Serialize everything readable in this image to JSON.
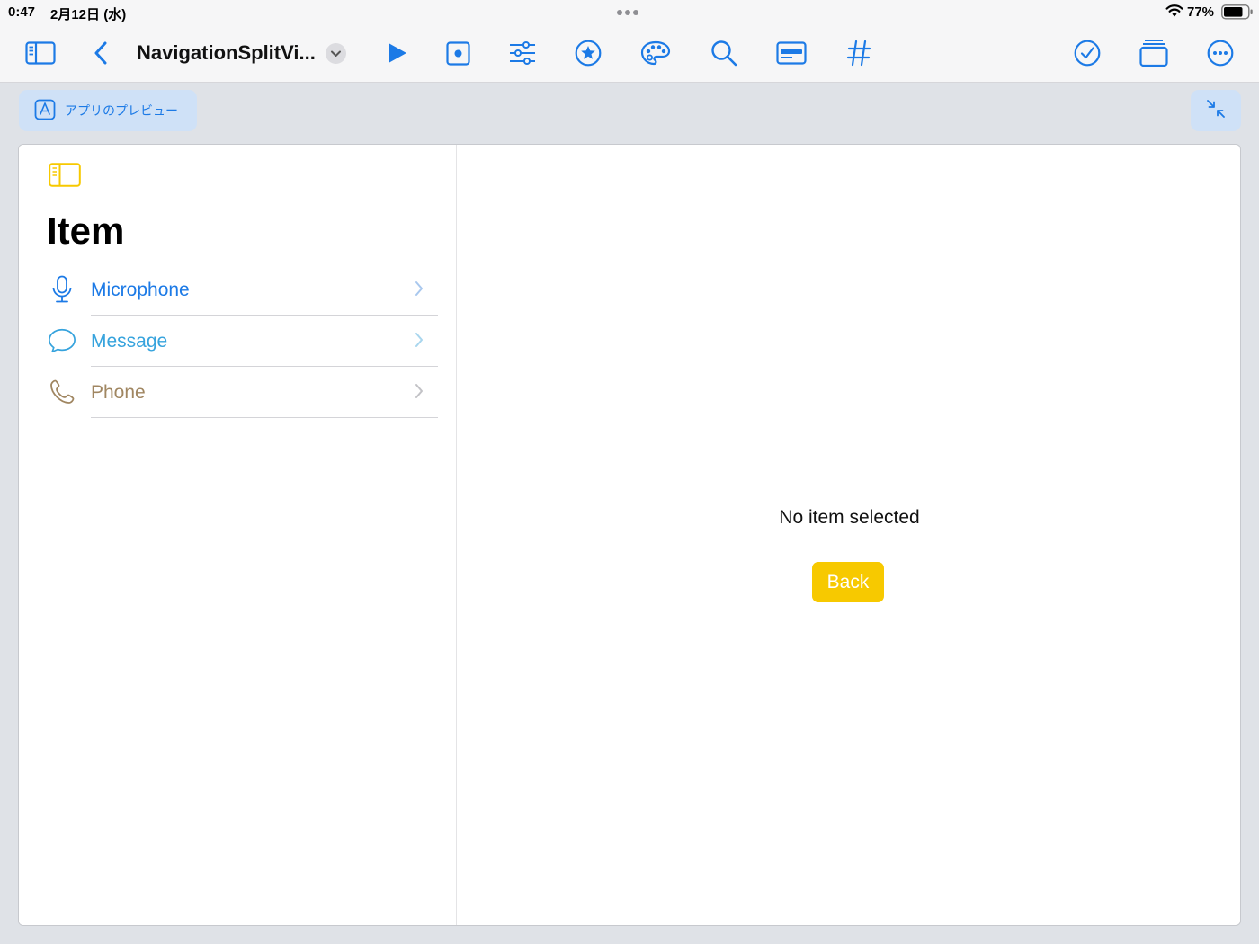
{
  "status_bar": {
    "time": "0:47",
    "date": "2月12日 (水)",
    "battery_percent": "77%",
    "battery_level": 0.77
  },
  "toolbar": {
    "document_title": "NavigationSplitVi...",
    "icons": [
      "sidebar-icon",
      "chevron-left-icon",
      "chevron-down-icon",
      "play-icon",
      "record-icon",
      "sliders-icon",
      "star-circle-icon",
      "palette-icon",
      "magnifier-icon",
      "card-icon",
      "hashtag-icon",
      "checkmark-circle-icon",
      "stack-icon",
      "ellipsis-circle-icon"
    ],
    "accent_color": "#1c7ae6"
  },
  "canvas": {
    "preview_label": "アプリのプレビュー"
  },
  "sidebar": {
    "title": "Item",
    "items": [
      {
        "label": "Microphone",
        "icon": "microphone-icon",
        "color": "#1c7ae6"
      },
      {
        "label": "Message",
        "icon": "message-bubble-icon",
        "color": "#36a3dd"
      },
      {
        "label": "Phone",
        "icon": "phone-icon",
        "color": "#a08661"
      }
    ],
    "toggle_color": "#f7c900"
  },
  "detail": {
    "empty_text": "No item selected",
    "back_label": "Back",
    "button_color": "#f7c900"
  }
}
